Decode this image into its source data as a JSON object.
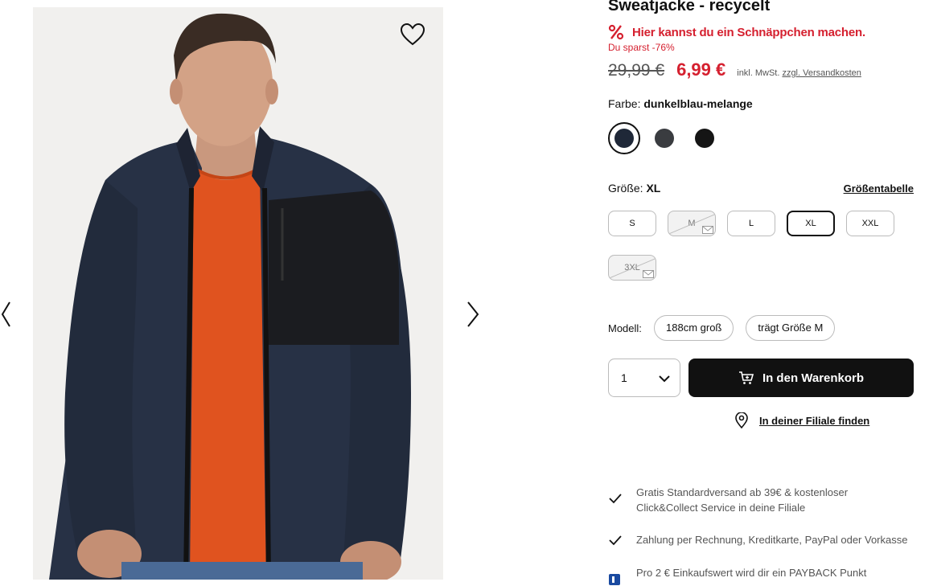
{
  "product": {
    "title": "Sweatjacke - recycelt",
    "deal_text": "Hier kannst du ein Schnäppchen machen.",
    "savings": "Du sparst -76%",
    "old_price": "29,99 €",
    "new_price": "6,99 €",
    "tax_note": "inkl. MwSt.",
    "shipping_link": "zzgl. Versandkosten"
  },
  "color": {
    "label": "Farbe:",
    "selected": "dunkelblau-melange",
    "swatches": [
      {
        "name": "dunkelblau-melange",
        "hex": "#1f2838",
        "selected": true
      },
      {
        "name": "grau",
        "hex": "#3a3c40",
        "selected": false
      },
      {
        "name": "schwarz",
        "hex": "#151515",
        "selected": false
      }
    ]
  },
  "size": {
    "label": "Größe:",
    "selected": "XL",
    "size_table_link": "Größentabelle",
    "options": [
      {
        "label": "S",
        "available": true
      },
      {
        "label": "M",
        "available": false
      },
      {
        "label": "L",
        "available": true
      },
      {
        "label": "XL",
        "available": true,
        "selected": true
      },
      {
        "label": "XXL",
        "available": true
      },
      {
        "label": "3XL",
        "available": false
      }
    ]
  },
  "model": {
    "label": "Modell:",
    "height": "188cm groß",
    "wears": "trägt Größe M"
  },
  "purchase": {
    "quantity": "1",
    "add_to_cart": "In den Warenkorb",
    "find_store": "In deiner Filiale finden"
  },
  "benefits": [
    {
      "text": "Gratis Standardversand ab 39€ & kostenloser Click&Collect Service in deine Filiale",
      "icon": "check-icon"
    },
    {
      "text": "Zahlung per Rechnung, Kreditkarte, PayPal oder Vorkasse",
      "icon": "check-icon"
    },
    {
      "text": "Pro 2 € Einkaufswert wird dir ein PAYBACK Punkt",
      "icon": "payback-icon"
    }
  ],
  "colors": {
    "accent_red": "#d5202f",
    "text_dark": "#111111",
    "jacket_navy": "#273145",
    "shirt_orange": "#e0531f"
  }
}
